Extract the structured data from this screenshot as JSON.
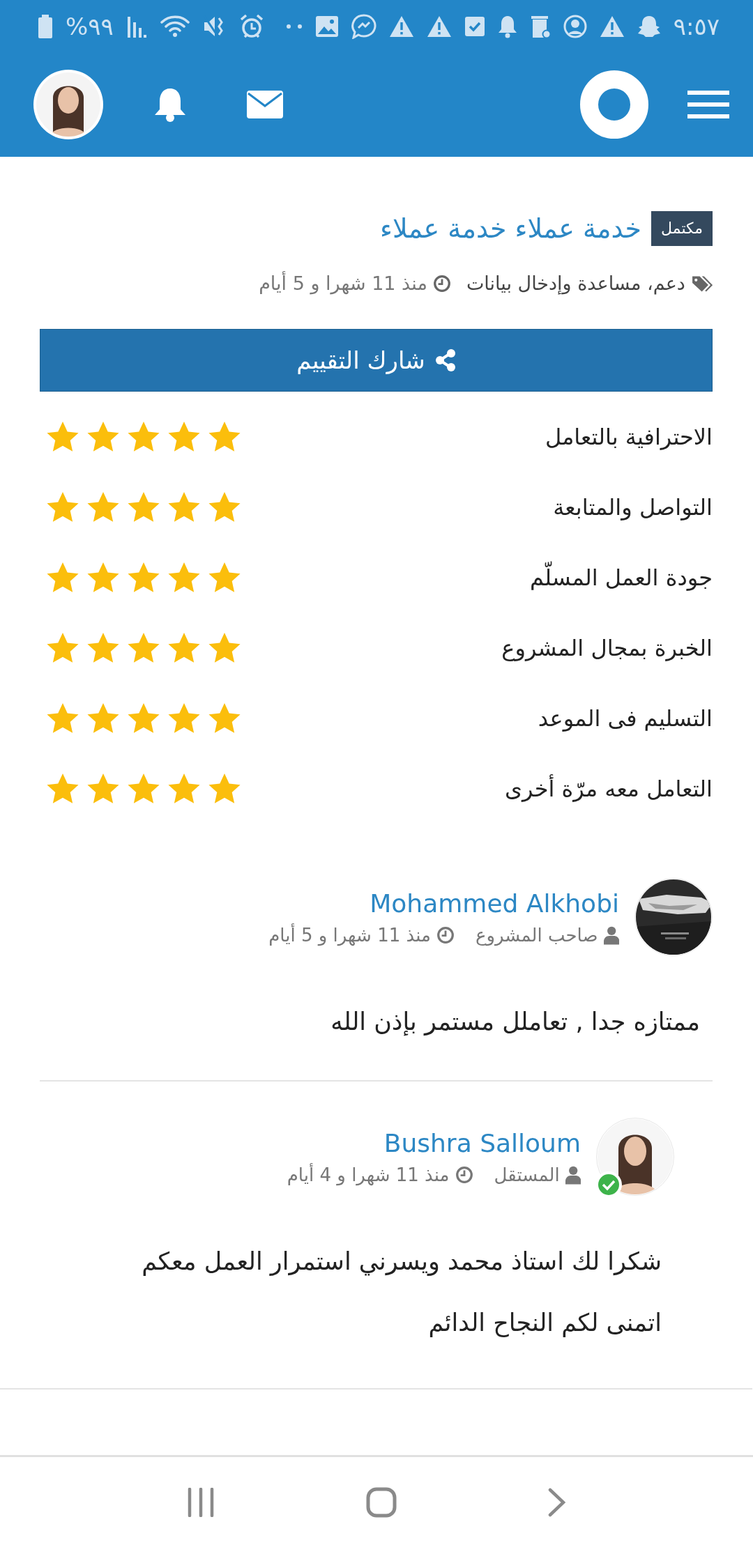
{
  "status_bar": {
    "battery": "%٩٩",
    "time": "٩:٥٧"
  },
  "project": {
    "status": "مكتمل",
    "title": "خدمة عملاء خدمة عملاء",
    "categories": "دعم، مساعدة وإدخال بيانات",
    "time": "منذ 11 شهرا و 5 أيام",
    "share_button": "شارك التقييم"
  },
  "ratings": [
    {
      "label": "الاحترافية بالتعامل",
      "stars": 5
    },
    {
      "label": "التواصل والمتابعة",
      "stars": 5
    },
    {
      "label": "جودة العمل المسلّم",
      "stars": 5
    },
    {
      "label": "الخبرة بمجال المشروع",
      "stars": 5
    },
    {
      "label": "التسليم فى الموعد",
      "stars": 5
    },
    {
      "label": "التعامل معه مرّة أخرى",
      "stars": 5
    }
  ],
  "reviews": [
    {
      "name": "Mohammed Alkhobi",
      "role": "صاحب المشروع",
      "time": "منذ 11 شهرا و 5 أيام",
      "comment": [
        "ممتازه جدا , تعاملل مستمر بإذن الله"
      ],
      "verified": false,
      "reply": false,
      "kind": "picture"
    },
    {
      "name": "Bushra Salloum",
      "role": "المستقل",
      "time": "منذ 11 شهرا و 4 أيام",
      "comment": [
        "شكرا لك استاذ محمد ويسرني استمرار العمل معكم",
        "اتمنى لكم النجاح الدائم"
      ],
      "verified": true,
      "reply": true,
      "kind": "person"
    }
  ]
}
